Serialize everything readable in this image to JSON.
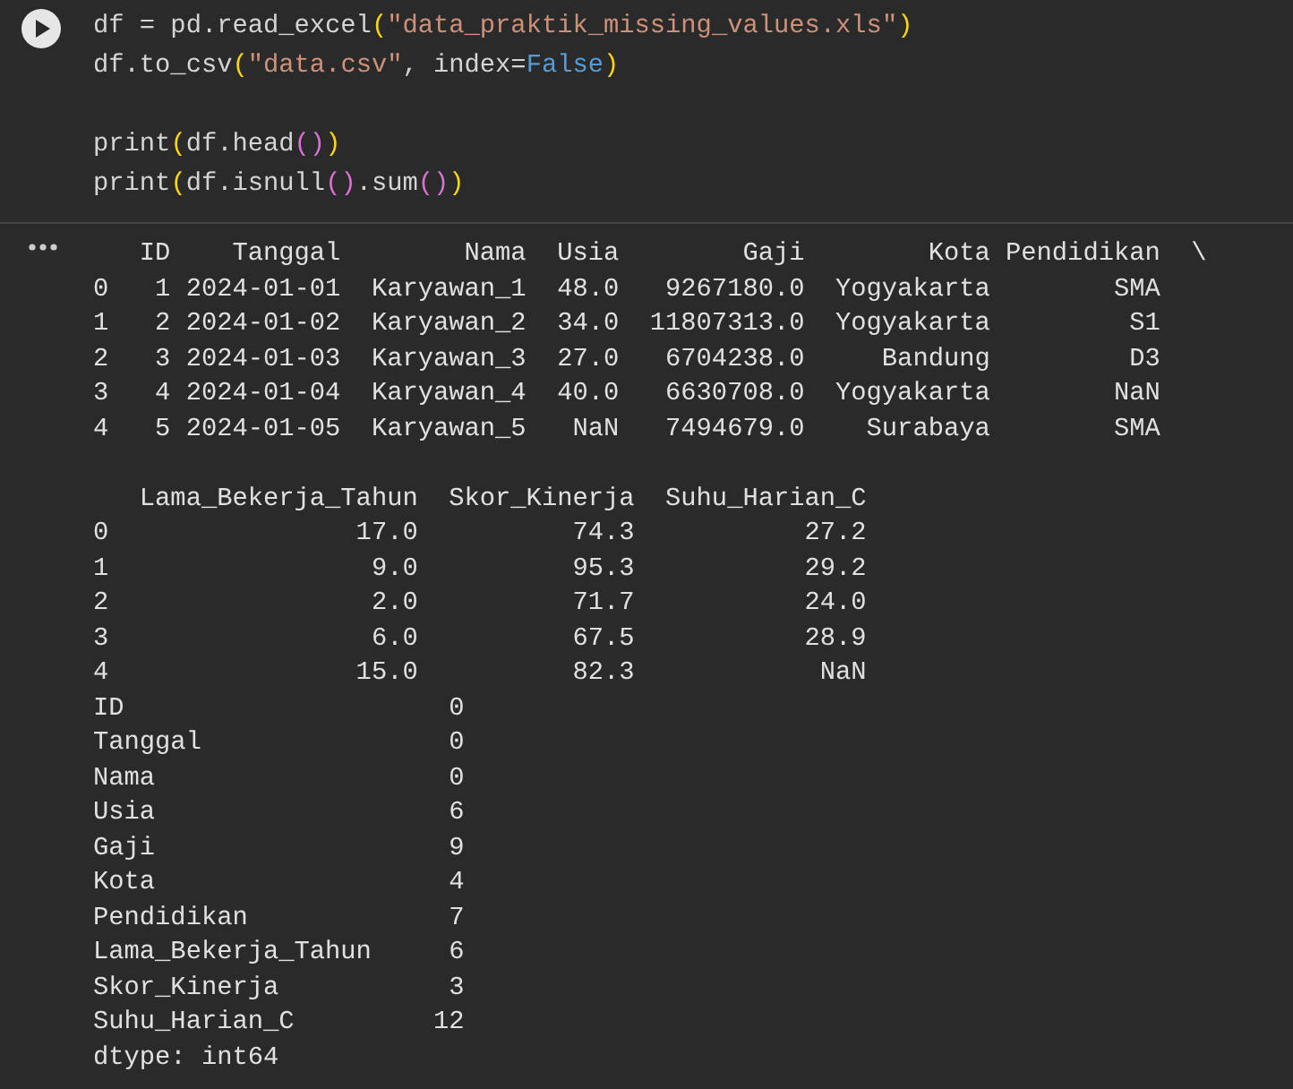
{
  "code_blocks": [
    [
      [
        {
          "kind": "plain",
          "text": "df = pd.read_excel"
        },
        {
          "kind": "paren",
          "text": "("
        },
        {
          "kind": "string",
          "text": "\"data_praktik_missing_values.xls\""
        },
        {
          "kind": "paren",
          "text": ")"
        }
      ],
      [
        {
          "kind": "plain",
          "text": "df.to_csv"
        },
        {
          "kind": "paren",
          "text": "("
        },
        {
          "kind": "string",
          "text": "\"data.csv\""
        },
        {
          "kind": "plain",
          "text": ", index="
        },
        {
          "kind": "keyword",
          "text": "False"
        },
        {
          "kind": "paren",
          "text": ")"
        }
      ]
    ],
    [
      [
        {
          "kind": "plain",
          "text": "print"
        },
        {
          "kind": "paren",
          "text": "("
        },
        {
          "kind": "plain",
          "text": "df.head"
        },
        {
          "kind": "paren2",
          "text": "()"
        },
        {
          "kind": "paren",
          "text": ")"
        }
      ],
      [
        {
          "kind": "plain",
          "text": "print"
        },
        {
          "kind": "paren",
          "text": "("
        },
        {
          "kind": "plain",
          "text": "df.isnull"
        },
        {
          "kind": "paren2",
          "text": "()"
        },
        {
          "kind": "plain",
          "text": ".sum"
        },
        {
          "kind": "paren2",
          "text": "()"
        },
        {
          "kind": "paren",
          "text": ")"
        }
      ]
    ]
  ],
  "output_blocks": [
    [
      "   ID    Tanggal        Nama  Usia        Gaji        Kota Pendidikan  \\",
      "0   1 2024-01-01  Karyawan_1  48.0   9267180.0  Yogyakarta        SMA",
      "1   2 2024-01-02  Karyawan_2  34.0  11807313.0  Yogyakarta         S1",
      "2   3 2024-01-03  Karyawan_3  27.0   6704238.0     Bandung         D3",
      "3   4 2024-01-04  Karyawan_4  40.0   6630708.0  Yogyakarta        NaN",
      "4   5 2024-01-05  Karyawan_5   NaN   7494679.0    Surabaya        SMA"
    ],
    [
      "   Lama_Bekerja_Tahun  Skor_Kinerja  Suhu_Harian_C",
      "0                17.0          74.3           27.2",
      "1                 9.0          95.3           29.2",
      "2                 2.0          71.7           24.0",
      "3                 6.0          67.5           28.9",
      "4                15.0          82.3            NaN",
      "ID                     0",
      "Tanggal                0",
      "Nama                   0",
      "Usia                   6",
      "Gaji                   9",
      "Kota                   4",
      "Pendidikan             7",
      "Lama_Bekerja_Tahun     6",
      "Skor_Kinerja           3",
      "Suhu_Harian_C         12",
      "dtype: int64"
    ]
  ]
}
